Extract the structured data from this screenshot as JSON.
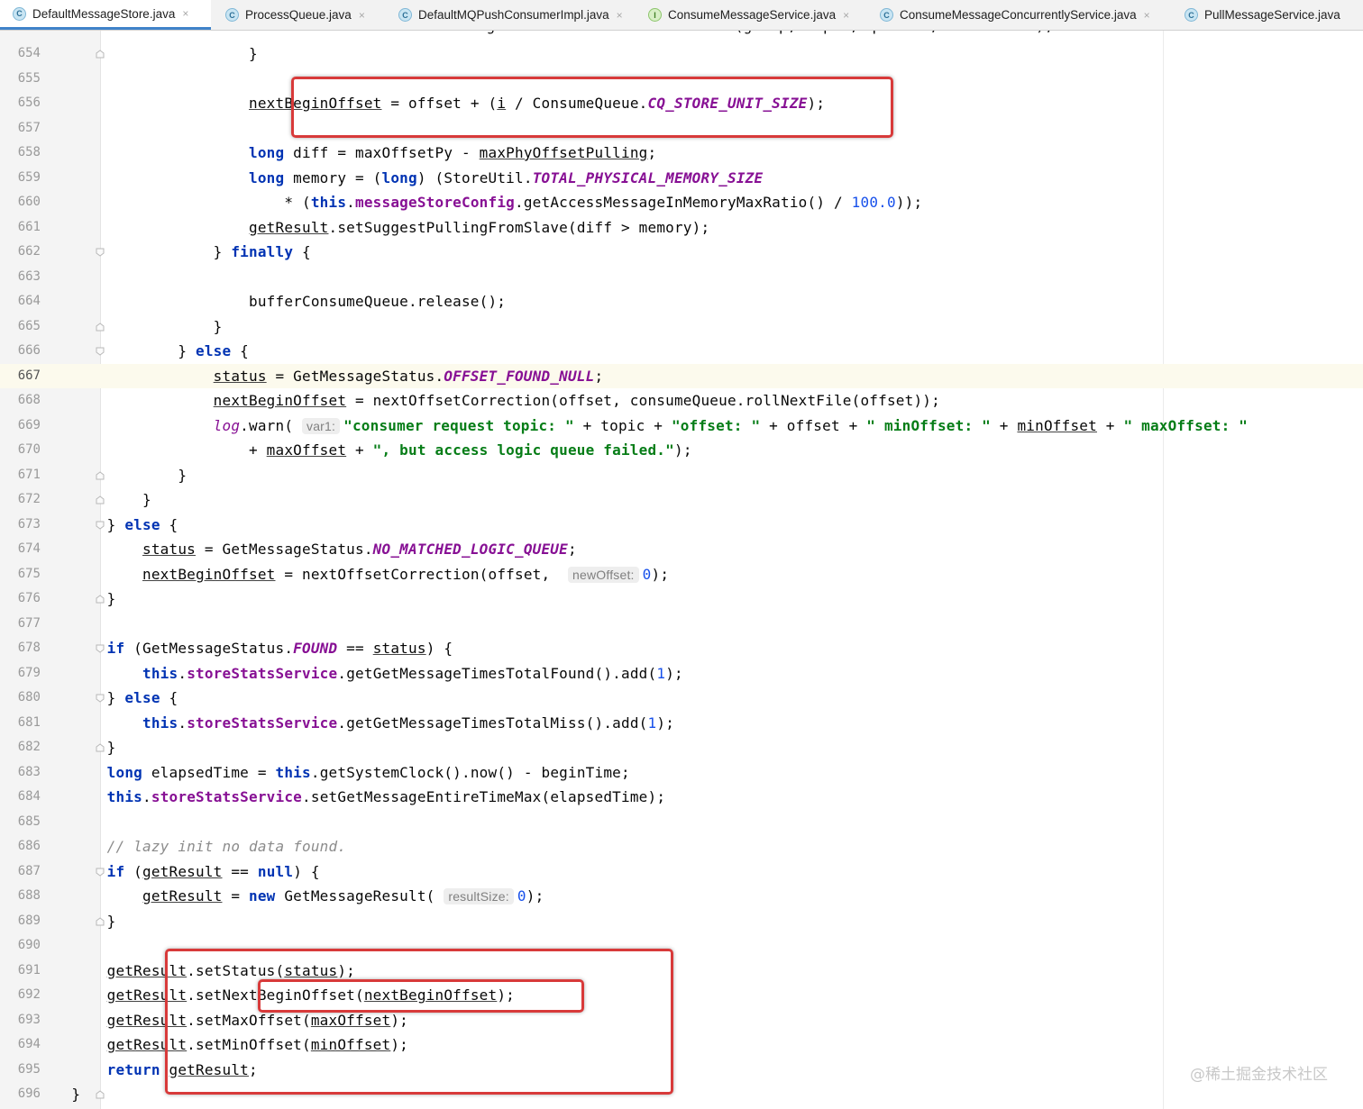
{
  "tabs": [
    {
      "name": "DefaultMessageStore.java",
      "icon": "class-icon",
      "letter": "C",
      "active": true
    },
    {
      "name": "ProcessQueue.java",
      "icon": "class-icon",
      "letter": "C",
      "active": false
    },
    {
      "name": "DefaultMQPushConsumerImpl.java",
      "icon": "class-icon",
      "letter": "C",
      "active": false
    },
    {
      "name": "ConsumeMessageService.java",
      "icon": "interface-icon",
      "letter": "I",
      "active": false
    },
    {
      "name": "ConsumeMessageConcurrentlyService.java",
      "icon": "class-icon",
      "letter": "C",
      "active": false
    },
    {
      "name": "PullMessageService.java",
      "icon": "class-icon",
      "letter": "C",
      "active": false
    }
  ],
  "tab_close_glyph": "×",
  "partial_top_line": "brokerStatsManager.recordDiskFallBehindSize(group, topic, queueId, fallBehind);",
  "current_line": 667,
  "lines": [
    {
      "n": 654,
      "fold": "end",
      "segs": [
        [
          "",
          "                        }"
        ]
      ]
    },
    {
      "n": 655,
      "segs": [
        [
          "",
          ""
        ]
      ]
    },
    {
      "n": 656,
      "segs": [
        [
          "",
          "                        "
        ],
        [
          "u",
          "nextBeginOffset"
        ],
        [
          "",
          " = offset + ("
        ],
        [
          "u",
          "i"
        ],
        [
          "",
          " / ConsumeQueue."
        ],
        [
          "cst",
          "CQ_STORE_UNIT_SIZE"
        ],
        [
          "",
          ");"
        ]
      ]
    },
    {
      "n": 657,
      "segs": [
        [
          "",
          ""
        ]
      ]
    },
    {
      "n": 658,
      "segs": [
        [
          "",
          "                        "
        ],
        [
          "kw",
          "long"
        ],
        [
          "",
          " diff = maxOffsetPy - "
        ],
        [
          "u",
          "maxPhyOffsetPulling"
        ],
        [
          "",
          ";"
        ]
      ]
    },
    {
      "n": 659,
      "segs": [
        [
          "",
          "                        "
        ],
        [
          "kw",
          "long"
        ],
        [
          "",
          " memory = ("
        ],
        [
          "kw",
          "long"
        ],
        [
          "",
          ") (StoreUtil."
        ],
        [
          "cst",
          "TOTAL_PHYSICAL_MEMORY_SIZE"
        ]
      ]
    },
    {
      "n": 660,
      "segs": [
        [
          "",
          "                            * ("
        ],
        [
          "kw",
          "this"
        ],
        [
          "",
          "."
        ],
        [
          "fld",
          "messageStoreConfig"
        ],
        [
          "",
          ".getAccessMessageInMemoryMaxRatio() / "
        ],
        [
          "num",
          "100.0"
        ],
        [
          "",
          "));"
        ]
      ]
    },
    {
      "n": 661,
      "segs": [
        [
          "",
          "                        "
        ],
        [
          "u",
          "getResult"
        ],
        [
          "",
          ".setSuggestPullingFromSlave(diff > memory);"
        ]
      ]
    },
    {
      "n": 662,
      "fold": "start",
      "segs": [
        [
          "",
          "                    } "
        ],
        [
          "kw",
          "finally"
        ],
        [
          "",
          " {"
        ]
      ]
    },
    {
      "n": 663,
      "segs": [
        [
          "",
          ""
        ]
      ]
    },
    {
      "n": 664,
      "segs": [
        [
          "",
          "                        bufferConsumeQueue.release();"
        ]
      ]
    },
    {
      "n": 665,
      "fold": "end",
      "segs": [
        [
          "",
          "                    }"
        ]
      ]
    },
    {
      "n": 666,
      "fold": "start",
      "segs": [
        [
          "",
          "                } "
        ],
        [
          "kw",
          "else"
        ],
        [
          "",
          " {"
        ]
      ]
    },
    {
      "n": 667,
      "segs": [
        [
          "",
          "                    "
        ],
        [
          "u",
          "status"
        ],
        [
          "",
          " = GetMessageStatus."
        ],
        [
          "cst",
          "OFFSET_FOUND_NULL"
        ],
        [
          "",
          ";"
        ]
      ]
    },
    {
      "n": 668,
      "segs": [
        [
          "",
          "                    "
        ],
        [
          "u",
          "nextBeginOffset"
        ],
        [
          "",
          " = nextOffsetCorrection(offset, consumeQueue.rollNextFile(offset));"
        ]
      ]
    },
    {
      "n": 669,
      "segs": [
        [
          "",
          "                    "
        ],
        [
          "sfld",
          "log"
        ],
        [
          "",
          ".warn( "
        ],
        [
          "hint",
          "var1:"
        ],
        [
          "str",
          "\"consumer request topic: \""
        ],
        [
          "",
          " + topic + "
        ],
        [
          "str",
          "\"offset: \""
        ],
        [
          "",
          " + offset + "
        ],
        [
          "str",
          "\" minOffset: \""
        ],
        [
          "",
          " + "
        ],
        [
          "u",
          "minOffset"
        ],
        [
          "",
          " + "
        ],
        [
          "str",
          "\" maxOffset: \""
        ]
      ]
    },
    {
      "n": 670,
      "segs": [
        [
          "",
          "                        + "
        ],
        [
          "u",
          "maxOffset"
        ],
        [
          "",
          " + "
        ],
        [
          "str",
          "\", but access logic queue failed.\""
        ],
        [
          "",
          ");"
        ]
      ]
    },
    {
      "n": 671,
      "fold": "end",
      "segs": [
        [
          "",
          "                }"
        ]
      ]
    },
    {
      "n": 672,
      "fold": "end",
      "segs": [
        [
          "",
          "            }"
        ]
      ]
    },
    {
      "n": 673,
      "fold": "start",
      "segs": [
        [
          "",
          "        } "
        ],
        [
          "kw",
          "else"
        ],
        [
          "",
          " {"
        ]
      ]
    },
    {
      "n": 674,
      "segs": [
        [
          "",
          "            "
        ],
        [
          "u",
          "status"
        ],
        [
          "",
          " = GetMessageStatus."
        ],
        [
          "cst",
          "NO_MATCHED_LOGIC_QUEUE"
        ],
        [
          "",
          ";"
        ]
      ]
    },
    {
      "n": 675,
      "segs": [
        [
          "",
          "            "
        ],
        [
          "u",
          "nextBeginOffset"
        ],
        [
          "",
          " = nextOffsetCorrection(offset,  "
        ],
        [
          "hint",
          "newOffset:"
        ],
        [
          "num",
          "0"
        ],
        [
          "",
          ");"
        ]
      ]
    },
    {
      "n": 676,
      "fold": "end",
      "segs": [
        [
          "",
          "        }"
        ]
      ]
    },
    {
      "n": 677,
      "segs": [
        [
          "",
          ""
        ]
      ]
    },
    {
      "n": 678,
      "fold": "start",
      "segs": [
        [
          "",
          "        "
        ],
        [
          "kw",
          "if"
        ],
        [
          "",
          " (GetMessageStatus."
        ],
        [
          "cst",
          "FOUND"
        ],
        [
          "",
          " == "
        ],
        [
          "u",
          "status"
        ],
        [
          "",
          ") {"
        ]
      ]
    },
    {
      "n": 679,
      "segs": [
        [
          "",
          "            "
        ],
        [
          "kw",
          "this"
        ],
        [
          "",
          "."
        ],
        [
          "fld",
          "storeStatsService"
        ],
        [
          "",
          ".getGetMessageTimesTotalFound().add("
        ],
        [
          "num",
          "1"
        ],
        [
          "",
          ");"
        ]
      ]
    },
    {
      "n": 680,
      "fold": "start",
      "segs": [
        [
          "",
          "        } "
        ],
        [
          "kw",
          "else"
        ],
        [
          "",
          " {"
        ]
      ]
    },
    {
      "n": 681,
      "segs": [
        [
          "",
          "            "
        ],
        [
          "kw",
          "this"
        ],
        [
          "",
          "."
        ],
        [
          "fld",
          "storeStatsService"
        ],
        [
          "",
          ".getGetMessageTimesTotalMiss().add("
        ],
        [
          "num",
          "1"
        ],
        [
          "",
          ");"
        ]
      ]
    },
    {
      "n": 682,
      "fold": "end",
      "segs": [
        [
          "",
          "        }"
        ]
      ]
    },
    {
      "n": 683,
      "segs": [
        [
          "",
          "        "
        ],
        [
          "kw",
          "long"
        ],
        [
          "",
          " elapsedTime = "
        ],
        [
          "kw",
          "this"
        ],
        [
          "",
          ".getSystemClock().now() - beginTime;"
        ]
      ]
    },
    {
      "n": 684,
      "segs": [
        [
          "",
          "        "
        ],
        [
          "kw",
          "this"
        ],
        [
          "",
          "."
        ],
        [
          "fld",
          "storeStatsService"
        ],
        [
          "",
          ".setGetMessageEntireTimeMax(elapsedTime);"
        ]
      ]
    },
    {
      "n": 685,
      "segs": [
        [
          "",
          ""
        ]
      ]
    },
    {
      "n": 686,
      "segs": [
        [
          "",
          "        "
        ],
        [
          "cmt",
          "// lazy init no data found."
        ]
      ]
    },
    {
      "n": 687,
      "fold": "start",
      "segs": [
        [
          "",
          "        "
        ],
        [
          "kw",
          "if"
        ],
        [
          "",
          " ("
        ],
        [
          "u",
          "getResult"
        ],
        [
          "",
          " == "
        ],
        [
          "kw",
          "null"
        ],
        [
          "",
          ") {"
        ]
      ]
    },
    {
      "n": 688,
      "segs": [
        [
          "",
          "            "
        ],
        [
          "u",
          "getResult"
        ],
        [
          "",
          " = "
        ],
        [
          "kw",
          "new"
        ],
        [
          "",
          " GetMessageResult( "
        ],
        [
          "hint",
          "resultSize:"
        ],
        [
          "num",
          "0"
        ],
        [
          "",
          ");"
        ]
      ]
    },
    {
      "n": 689,
      "fold": "end",
      "segs": [
        [
          "",
          "        }"
        ]
      ]
    },
    {
      "n": 690,
      "segs": [
        [
          "",
          ""
        ]
      ]
    },
    {
      "n": 691,
      "segs": [
        [
          "",
          "        "
        ],
        [
          "u",
          "getResult"
        ],
        [
          "",
          ".setStatus("
        ],
        [
          "u",
          "status"
        ],
        [
          "",
          ");"
        ]
      ]
    },
    {
      "n": 692,
      "segs": [
        [
          "",
          "        "
        ],
        [
          "u",
          "getResult"
        ],
        [
          "",
          ".setNextBeginOffset("
        ],
        [
          "u",
          "nextBeginOffset"
        ],
        [
          "",
          ");"
        ]
      ]
    },
    {
      "n": 693,
      "segs": [
        [
          "",
          "        "
        ],
        [
          "u",
          "getResult"
        ],
        [
          "",
          ".setMaxOffset("
        ],
        [
          "u",
          "maxOffset"
        ],
        [
          "",
          ");"
        ]
      ]
    },
    {
      "n": 694,
      "segs": [
        [
          "",
          "        "
        ],
        [
          "u",
          "getResult"
        ],
        [
          "",
          ".setMinOffset("
        ],
        [
          "u",
          "minOffset"
        ],
        [
          "",
          ");"
        ]
      ]
    },
    {
      "n": 695,
      "segs": [
        [
          "",
          "        "
        ],
        [
          "kw",
          "return"
        ],
        [
          "",
          " "
        ],
        [
          "u",
          "getResult"
        ],
        [
          "",
          ";"
        ]
      ]
    },
    {
      "n": 696,
      "fold": "end",
      "segs": [
        [
          "",
          "    }"
        ]
      ]
    }
  ],
  "watermark": "@稀土掘金技术社区",
  "colors": {
    "highlight_box": "#d83a3a",
    "keyword": "#0033b3",
    "field": "#871094",
    "string": "#067d17",
    "number": "#1750eb",
    "active_tab_underline": "#4083c9"
  }
}
